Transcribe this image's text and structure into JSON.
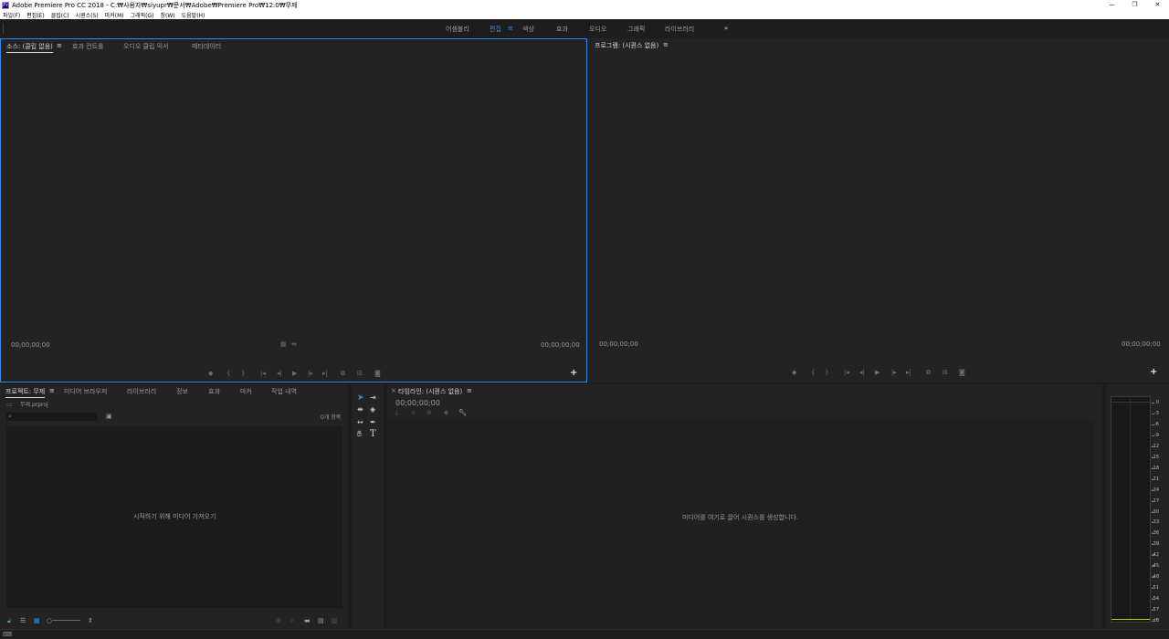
{
  "window": {
    "title": "Adobe Premiere Pro CC 2018 - C:₩사용자₩siyupr₩문서₩Adobe₩Premiere Pro₩12.0₩무제",
    "minimize": "—",
    "restore": "❐",
    "close": "✕"
  },
  "menu": [
    "파일(F)",
    "편집(E)",
    "클립(C)",
    "시퀀스(S)",
    "마커(M)",
    "그래픽(G)",
    "창(W)",
    "도움말(H)"
  ],
  "workspaces": {
    "tabs": [
      "어셈블리",
      "편집",
      "색상",
      "효과",
      "오디오",
      "그래픽",
      "라이브러리"
    ],
    "active": "편집",
    "active_menu": "≡",
    "overflow": "»"
  },
  "source": {
    "tabs": [
      "소스: (클립 없음)",
      "효과 컨트롤",
      "오디오 클립 믹서",
      "메타데이터"
    ],
    "tab_menu": "≡",
    "tc_left": "00;00;00;00",
    "tc_right": "00;00;00;00",
    "add": "+"
  },
  "program": {
    "tab": "프로그램: (시퀀스 없음)",
    "tab_menu": "≡",
    "tc_left": "00;00;00;00",
    "tc_right": "00;00;00;00",
    "add": "+"
  },
  "project": {
    "tabs": [
      "프로젝트: 무제",
      "미디어 브라우저",
      "라이브러리",
      "정보",
      "효과",
      "마커",
      "작업 내역"
    ],
    "tab_menu": "≡",
    "file": "무제.prproj",
    "item_count": "0개 항목",
    "empty_message": "시작하기 위해 미디어 가져오기"
  },
  "timeline": {
    "tab": "타임라인: (시퀀스 없음)",
    "tab_menu": "≡",
    "close": "×",
    "tc": "00;00;00;00",
    "empty_message": "미디어를 여기로 끌어 시퀀스를 생성합니다."
  },
  "audio_meter": {
    "labels": [
      "0",
      "-3",
      "-6",
      "-9",
      "-12",
      "-15",
      "-18",
      "-21",
      "-24",
      "-27",
      "-30",
      "-33",
      "-36",
      "-39",
      "-42",
      "-45",
      "-48",
      "-51",
      "-54",
      "-57",
      "dB"
    ]
  },
  "accent_color": "#2d8ceb"
}
